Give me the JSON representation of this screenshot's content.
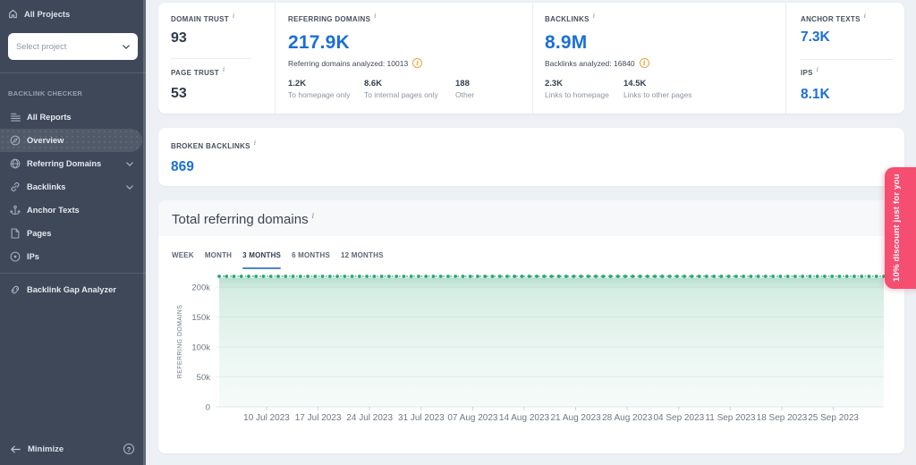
{
  "sidebar": {
    "all_projects_label": "All Projects",
    "select_project_placeholder": "Select project",
    "section_label": "BACKLINK CHECKER",
    "items": [
      {
        "label": "All Reports",
        "icon": "reports-icon",
        "active": false,
        "expandable": false
      },
      {
        "label": "Overview",
        "icon": "overview-icon",
        "active": true,
        "expandable": false
      },
      {
        "label": "Referring Domains",
        "icon": "globe-icon",
        "active": false,
        "expandable": true
      },
      {
        "label": "Backlinks",
        "icon": "link-icon",
        "active": false,
        "expandable": true
      },
      {
        "label": "Anchor Texts",
        "icon": "anchor-icon",
        "active": false,
        "expandable": false
      },
      {
        "label": "Pages",
        "icon": "page-icon",
        "active": false,
        "expandable": false
      },
      {
        "label": "IPs",
        "icon": "target-icon",
        "active": false,
        "expandable": false
      }
    ],
    "tools": [
      {
        "label": "Backlink Gap Analyzer",
        "icon": "gap-analyzer-icon"
      }
    ],
    "minimize_label": "Minimize",
    "help_label": "?"
  },
  "metrics": {
    "domain_trust": {
      "label": "DOMAIN TRUST",
      "value": "93"
    },
    "page_trust": {
      "label": "PAGE TRUST",
      "value": "53"
    },
    "referring_domains": {
      "label": "REFERRING DOMAINS",
      "value": "217.9K",
      "analyzed": "Referring domains analyzed: 10013",
      "breakdown": [
        {
          "value": "1.2K",
          "label": "To homepage only"
        },
        {
          "value": "8.6K",
          "label": "To internal pages only"
        },
        {
          "value": "188",
          "label": "Other"
        }
      ]
    },
    "backlinks": {
      "label": "BACKLINKS",
      "value": "8.9M",
      "analyzed": "Backlinks analyzed: 16840",
      "breakdown": [
        {
          "value": "2.3K",
          "label": "Links to homepage"
        },
        {
          "value": "14.5K",
          "label": "Links to other pages"
        }
      ]
    },
    "anchor_texts": {
      "label": "ANCHOR TEXTS",
      "value": "7.3K"
    },
    "ips": {
      "label": "IPS",
      "value": "8.1K"
    },
    "broken_backlinks": {
      "label": "BROKEN BACKLINKS",
      "value": "869"
    }
  },
  "chart_section": {
    "title": "Total referring domains",
    "tabs": [
      {
        "label": "WEEK",
        "active": false
      },
      {
        "label": "MONTH",
        "active": false
      },
      {
        "label": "3 MONTHS",
        "active": true
      },
      {
        "label": "6 MONTHS",
        "active": false
      },
      {
        "label": "12 MONTHS",
        "active": false
      }
    ]
  },
  "chart_data": {
    "type": "area",
    "title": "Total referring domains",
    "ylabel": "REFERRING DOMAINS",
    "xlabel": "",
    "ylim": [
      0,
      228000
    ],
    "y_ticks": [
      0,
      50000,
      100000,
      150000,
      200000
    ],
    "y_tick_labels": [
      "0",
      "50k",
      "100k",
      "150k",
      "200k"
    ],
    "x_tick_labels": [
      "10 Jul 2023",
      "17 Jul 2023",
      "24 Jul 2023",
      "31 Jul 2023",
      "07 Aug 2023",
      "14 Aug 2023",
      "21 Aug 2023",
      "28 Aug 2023",
      "04 Sep 2023",
      "11 Sep 2023",
      "18 Sep 2023",
      "25 Sep 2023"
    ],
    "grid": true,
    "legend_position": "none",
    "series": [
      {
        "name": "Referring domains",
        "style": "dotted-line-with-area",
        "color": "#2fa474",
        "num_points": 91,
        "point_interval": "daily",
        "constant_value": 217900,
        "values_note": "flat daily series at ~217.9K referring domains across the 3-month range"
      }
    ]
  },
  "ribbon": {
    "text": "10% discount just for you",
    "color": "#f54e71"
  },
  "colors": {
    "sidebar_bg": "#3e4859",
    "main_bg": "#edf0f4",
    "card_bg": "#ffffff",
    "accent_blue": "#1b6fd6",
    "tab_underline": "#4c86c9",
    "chart_green": "#2fa474",
    "info_orange": "#eba23e",
    "ribbon_pink": "#f54e71"
  }
}
